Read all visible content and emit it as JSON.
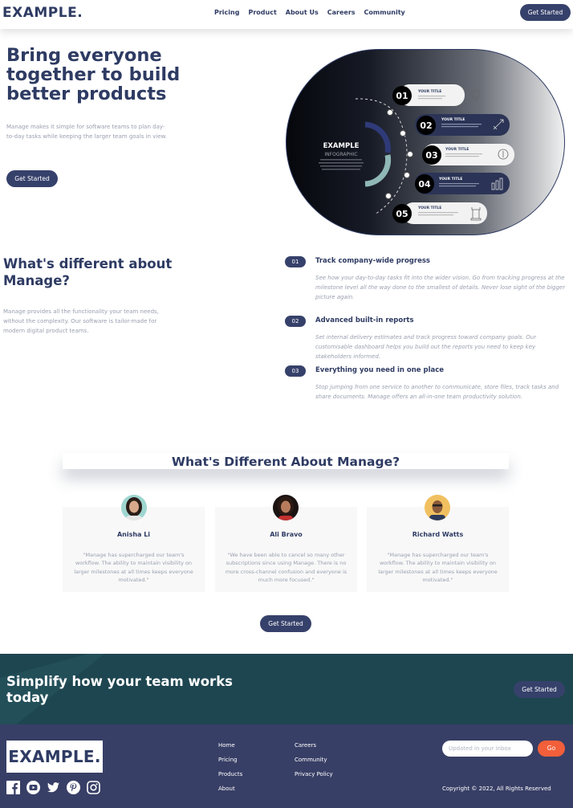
{
  "brand": {
    "logo": "EXAMPLE."
  },
  "nav": {
    "links": [
      "Pricing",
      "Product",
      "About Us",
      "Careers",
      "Community"
    ],
    "cta": "Get Started"
  },
  "hero": {
    "title": "Bring everyone together to build better products",
    "text": "Manage makes it simple for software teams to plan day-to-day tasks while keeping the larger team goals in view.",
    "cta": "Get Started",
    "infographic": {
      "center_title": "EXAMPLE",
      "center_sub": "INFOGRAPHIC",
      "steps": [
        {
          "num": "01",
          "title": "YOUR TITLE",
          "icon": "lightbulb-icon"
        },
        {
          "num": "02",
          "title": "YOUR TITLE",
          "icon": "rocket-icon"
        },
        {
          "num": "03",
          "title": "YOUR TITLE",
          "icon": "compass-icon"
        },
        {
          "num": "04",
          "title": "YOUR TITLE",
          "icon": "bar-chart-icon"
        },
        {
          "num": "05",
          "title": "YOUR TITLE",
          "icon": "chess-rook-icon"
        }
      ]
    }
  },
  "different": {
    "title": "What's different about Manage?",
    "text": "Manage provides all the functionality your team needs, without the complexity. Our software is tailor-made for modern digital product teams.",
    "features": [
      {
        "num": "01",
        "title": "Track company-wide progress",
        "desc": "See how your day-to-day tasks fit into the wider vision. Go from tracking progress at the milestone level all the way done to the smallest of details. Never lose sight of the bigger picture again."
      },
      {
        "num": "02",
        "title": "Advanced built-in reports",
        "desc": "Set internal delivery estimates and track progress toward company goals. Our customisable dashboard helps you build out the reports you need to keep key stakeholders informed."
      },
      {
        "num": "03",
        "title": "Everything you need in one place",
        "desc": "Stop jumping from one service to another to communicate, store files, track tasks and share documents. Manage offers an all-in-one team productivity solution."
      }
    ]
  },
  "testimonials": {
    "title": "What's Different About Manage?",
    "items": [
      {
        "name": "Anisha Li",
        "quote": "\"Manage has supercharged our team's workflow. The ability to maintain visibility on larger milestones at all times keeps everyone motivated.\""
      },
      {
        "name": "Ali Bravo",
        "quote": "\"We have been able to cancel so many other subscriptions since using Manage. There is no more cross-channel confusion and everyone is much more focused.\""
      },
      {
        "name": "Richard Watts",
        "quote": "\"Manage has supercharged our team's workflow. The ability to maintain visibility on larger milestones at all times keeps everyone motivated.\""
      }
    ],
    "cta": "Get Started"
  },
  "cta_band": {
    "title": "Simplify how your team works today",
    "cta": "Get Started"
  },
  "footer": {
    "logo": "EXAMPLE.",
    "col1": [
      "Home",
      "Pricing",
      "Products",
      "About"
    ],
    "col2": [
      "Careers",
      "Community",
      "Privacy Policy"
    ],
    "subscribe_placeholder": "Updated in your inbox",
    "go": "Go",
    "copyright": "Copyright © 2022, All Rights Reserved",
    "socials": [
      "facebook-icon",
      "youtube-icon",
      "twitter-icon",
      "pinterest-icon",
      "instagram-icon"
    ]
  },
  "colors": {
    "primary": "#36416b",
    "accent": "#f25f3a",
    "cta_band": "#1e4650",
    "footer": "#383f66"
  }
}
